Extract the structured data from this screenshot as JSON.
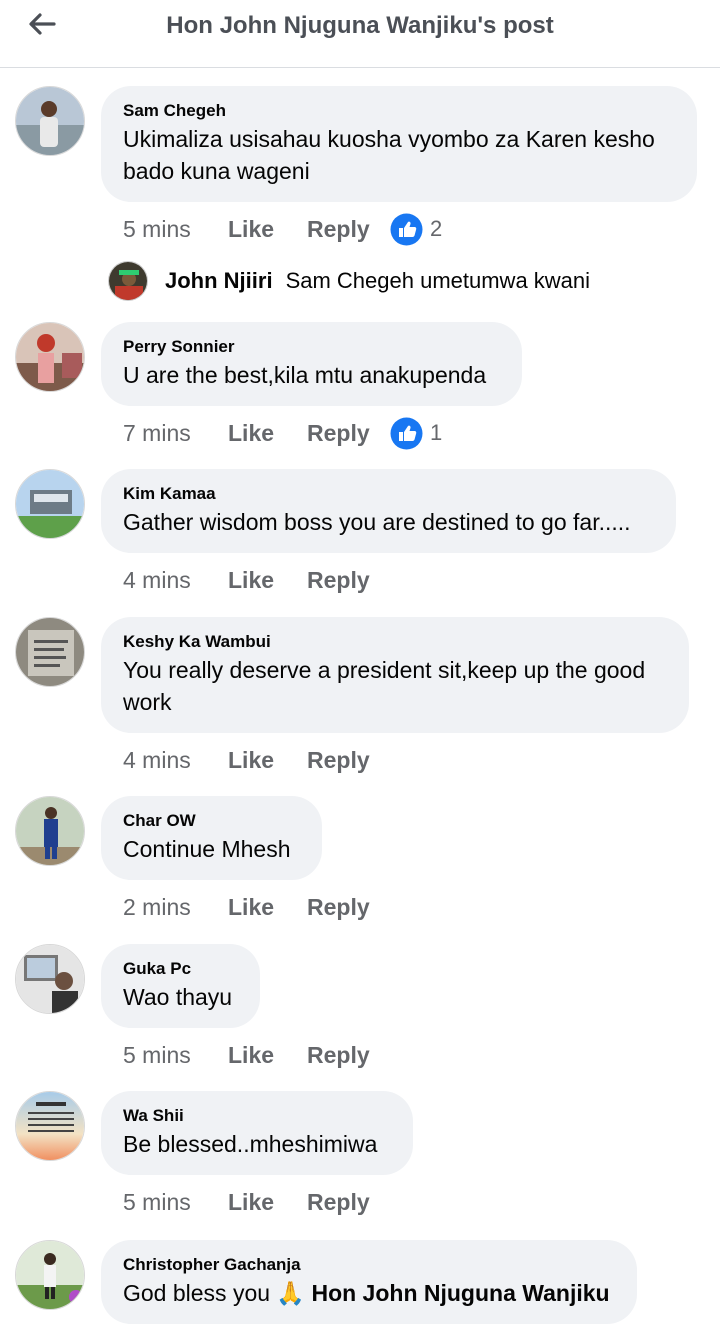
{
  "header": {
    "title": "Hon John Njuguna Wanjiku's post",
    "back_icon": "arrow-left-icon"
  },
  "comments": [
    {
      "author": "Sam Chegeh",
      "text": "Ukimaliza usisahau kuosha vyombo za Karen kesho bado kuna wageni",
      "time": "5 mins",
      "like": "Like",
      "reply": "Reply",
      "reactions": "2"
    },
    {
      "author": "Perry Sonnier",
      "text": "U are the best,kila mtu anakupenda",
      "time": "7 mins",
      "like": "Like",
      "reply": "Reply",
      "reactions": "1"
    },
    {
      "author": "Kim Kamaa",
      "text": "Gather wisdom boss you are destined to go far.....",
      "time": "4 mins",
      "like": "Like",
      "reply": "Reply"
    },
    {
      "author": "Keshy Ka Wambui",
      "text": "You really deserve a president sit,keep up the good work",
      "time": "4 mins",
      "like": "Like",
      "reply": "Reply"
    },
    {
      "author": "Char OW",
      "text": "Continue Mhesh",
      "time": "2 mins",
      "like": "Like",
      "reply": "Reply"
    },
    {
      "author": "Guka Pc",
      "text": "Wao thayu",
      "time": "5 mins",
      "like": "Like",
      "reply": "Reply"
    },
    {
      "author": "Wa Shii",
      "text": "Be blessed..mheshimiwa",
      "time": "5 mins",
      "like": "Like",
      "reply": "Reply"
    },
    {
      "author": "Christopher Gachanja",
      "text_prefix": "God bless you",
      "emoji": "🙏",
      "tag": "Hon John Njuguna Wanjiku"
    }
  ],
  "nested_reply": {
    "author": "John Njiiri",
    "text": "Sam Chegeh umetumwa kwani"
  },
  "colors": {
    "like_blue": "#1877f2",
    "bubble_bg": "#f0f2f5",
    "meta_gray": "#65676b"
  }
}
